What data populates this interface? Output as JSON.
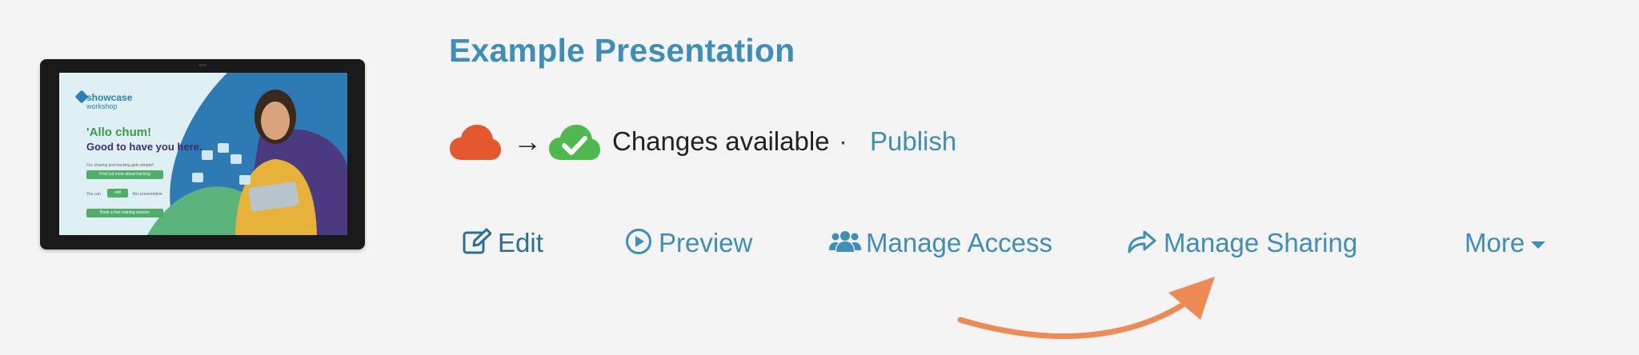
{
  "presentation": {
    "title": "Example Presentation"
  },
  "thumbnail": {
    "logo_name": "showcase",
    "logo_sub": "workshop",
    "heading": "'Allo chum!",
    "subheading": "Good to have you here.",
    "small_text": "Our sharing and tracking gets simpler!",
    "button1": "Find out more about tracking",
    "button2_prefix": "You can",
    "button2": "edit",
    "button2_suffix": "this presentation",
    "button3": "Book a free training session"
  },
  "status": {
    "source_icon": "cloud-icon",
    "target_icon": "cloud-check-icon",
    "arrow": "→",
    "label": "Changes available",
    "separator": "·",
    "publish_label": "Publish",
    "colors": {
      "source_cloud": "#e4582f",
      "target_cloud": "#4fb84f"
    }
  },
  "actions": {
    "edit": {
      "label": "Edit",
      "icon": "edit-icon"
    },
    "preview": {
      "label": "Preview",
      "icon": "play-circle-icon"
    },
    "manage_access": {
      "label": "Manage Access",
      "icon": "users-icon"
    },
    "manage_sharing": {
      "label": "Manage Sharing",
      "icon": "share-icon"
    },
    "more": {
      "label": "More",
      "icon": "caret-down-icon"
    }
  },
  "annotation": {
    "color": "#ee8a55",
    "points_to": "Manage Sharing"
  },
  "colors": {
    "link": "#3e8eb8",
    "background": "#f4f4f4"
  }
}
